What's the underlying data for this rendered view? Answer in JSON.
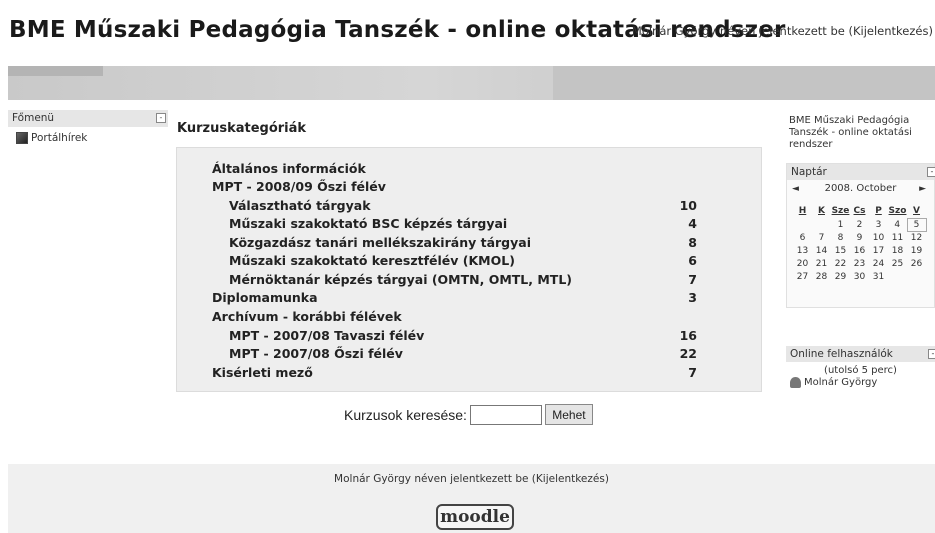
{
  "header": {
    "site_title": "BME Műszaki Pedagógia Tanszék - online oktatási rendszer",
    "login_prefix": "Molnár György néven jelentkezett be (",
    "logout_label": "Kijelentkezés",
    "login_suffix": ")"
  },
  "main_menu": {
    "title": "Főmenü",
    "toggle": "-",
    "items": [
      {
        "label": "Portálhírek",
        "icon": "news-icon"
      }
    ]
  },
  "course_categories": {
    "title": "Kurzuskategóriák",
    "rows": [
      {
        "name": "Általános információk",
        "count": ""
      },
      {
        "name": "MPT - 2008/09 Őszi félév",
        "count": ""
      },
      {
        "name": "Választható tárgyak",
        "count": "10"
      },
      {
        "name": "Műszaki szakoktató BSC képzés tárgyai",
        "count": "4"
      },
      {
        "name": "Közgazdász tanári mellékszakirány tárgyai",
        "count": "8"
      },
      {
        "name": "Műszaki szakoktató keresztfélév (KMOL)",
        "count": "6"
      },
      {
        "name": "Mérnöktanár képzés tárgyai (OMTN, OMTL, MTL)",
        "count": "7"
      },
      {
        "name": "Diplomamunka",
        "count": "3"
      },
      {
        "name": "Archívum - korábbi félévek",
        "count": ""
      },
      {
        "name": "MPT - 2007/08 Tavaszi félév",
        "count": "16"
      },
      {
        "name": "MPT - 2007/08 Őszi félév",
        "count": "22"
      },
      {
        "name": "Kisérleti mező",
        "count": "7"
      }
    ]
  },
  "search": {
    "label": "Kurzusok keresése:",
    "value": "",
    "button": "Mehet"
  },
  "right_site": {
    "name": "BME Műszaki Pedagógia Tanszék - online oktatási rendszer"
  },
  "calendar": {
    "title": "Naptár",
    "toggle": "-",
    "month": "2008. October",
    "prev": "◄",
    "next": "►",
    "weekdays": [
      "H",
      "K",
      "Sze",
      "Cs",
      "P",
      "Szo",
      "V"
    ],
    "weeks": [
      [
        "",
        "",
        "1",
        "2",
        "3",
        "4",
        "5"
      ],
      [
        "6",
        "7",
        "8",
        "9",
        "10",
        "11",
        "12"
      ],
      [
        "13",
        "14",
        "15",
        "16",
        "17",
        "18",
        "19"
      ],
      [
        "20",
        "21",
        "22",
        "23",
        "24",
        "25",
        "26"
      ],
      [
        "27",
        "28",
        "29",
        "30",
        "31",
        "",
        ""
      ]
    ],
    "today": "5"
  },
  "online_users": {
    "title": "Online felhasználók",
    "toggle": "-",
    "subtitle": "(utolsó 5 perc)",
    "users": [
      "Molnár György"
    ]
  },
  "footer": {
    "login_prefix": "Molnár György néven jelentkezett be (",
    "logout_label": "Kijelentkezés",
    "login_suffix": ")",
    "logo_text": "moodle"
  }
}
